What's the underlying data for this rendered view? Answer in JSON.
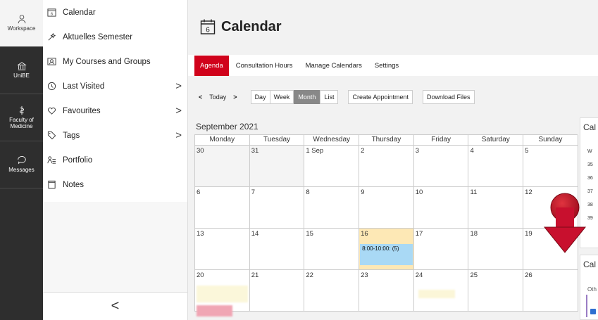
{
  "rail": [
    {
      "label": "Workspace",
      "icon": "person-icon",
      "active": true
    },
    {
      "label": "UniBE",
      "icon": "university-icon"
    },
    {
      "label": "Faculty of Medicine",
      "icon": "medicine-icon"
    },
    {
      "label": "Messages",
      "icon": "messages-icon"
    }
  ],
  "nav": {
    "items": [
      {
        "label": "Calendar",
        "icon": "calendar-icon"
      },
      {
        "label": "Aktuelles Semester",
        "icon": "wizard-icon"
      },
      {
        "label": "My Courses and Groups",
        "icon": "courses-icon"
      },
      {
        "label": "Last Visited",
        "icon": "clock-icon",
        "chevron": ">"
      },
      {
        "label": "Favourites",
        "icon": "heart-icon",
        "chevron": ">"
      },
      {
        "label": "Tags",
        "icon": "tag-icon",
        "chevron": ">"
      },
      {
        "label": "Portfolio",
        "icon": "portfolio-icon"
      },
      {
        "label": "Notes",
        "icon": "note-icon"
      }
    ],
    "collapse": "<"
  },
  "header": {
    "title": "Calendar",
    "icon_day": "6"
  },
  "tabs": [
    "Agenda",
    "Consultation Hours",
    "Manage Calendars",
    "Settings"
  ],
  "toolbar": {
    "prev": "<",
    "today": "Today",
    "next": ">",
    "views": [
      "Day",
      "Week",
      "Month",
      "List"
    ],
    "active_view": "Month",
    "create": "Create Appointment",
    "download": "Download Files"
  },
  "month_label": "September 2021",
  "weekdays": [
    "Monday",
    "Tuesday",
    "Wednesday",
    "Thursday",
    "Friday",
    "Saturday",
    "Sunday"
  ],
  "weeks": [
    [
      "30",
      "31",
      "1 Sep",
      "2",
      "3",
      "4",
      "5"
    ],
    [
      "6",
      "7",
      "8",
      "9",
      "10",
      "11",
      "12"
    ],
    [
      "13",
      "14",
      "15",
      "16",
      "17",
      "18",
      "19"
    ],
    [
      "20",
      "21",
      "22",
      "23",
      "24",
      "25",
      "26"
    ]
  ],
  "event": {
    "text": "8:00-10:00: (5)"
  },
  "side1": {
    "title": "Cal",
    "week_header": "W",
    "weeks": [
      "35",
      "36",
      "37",
      "38",
      "39"
    ]
  },
  "side2": {
    "title": "Cal",
    "other": "Oth"
  },
  "colors": {
    "accent": "#d0021b",
    "event": "#a9d9f5",
    "today": "#fde8b5",
    "arrow": "#c8102e"
  }
}
